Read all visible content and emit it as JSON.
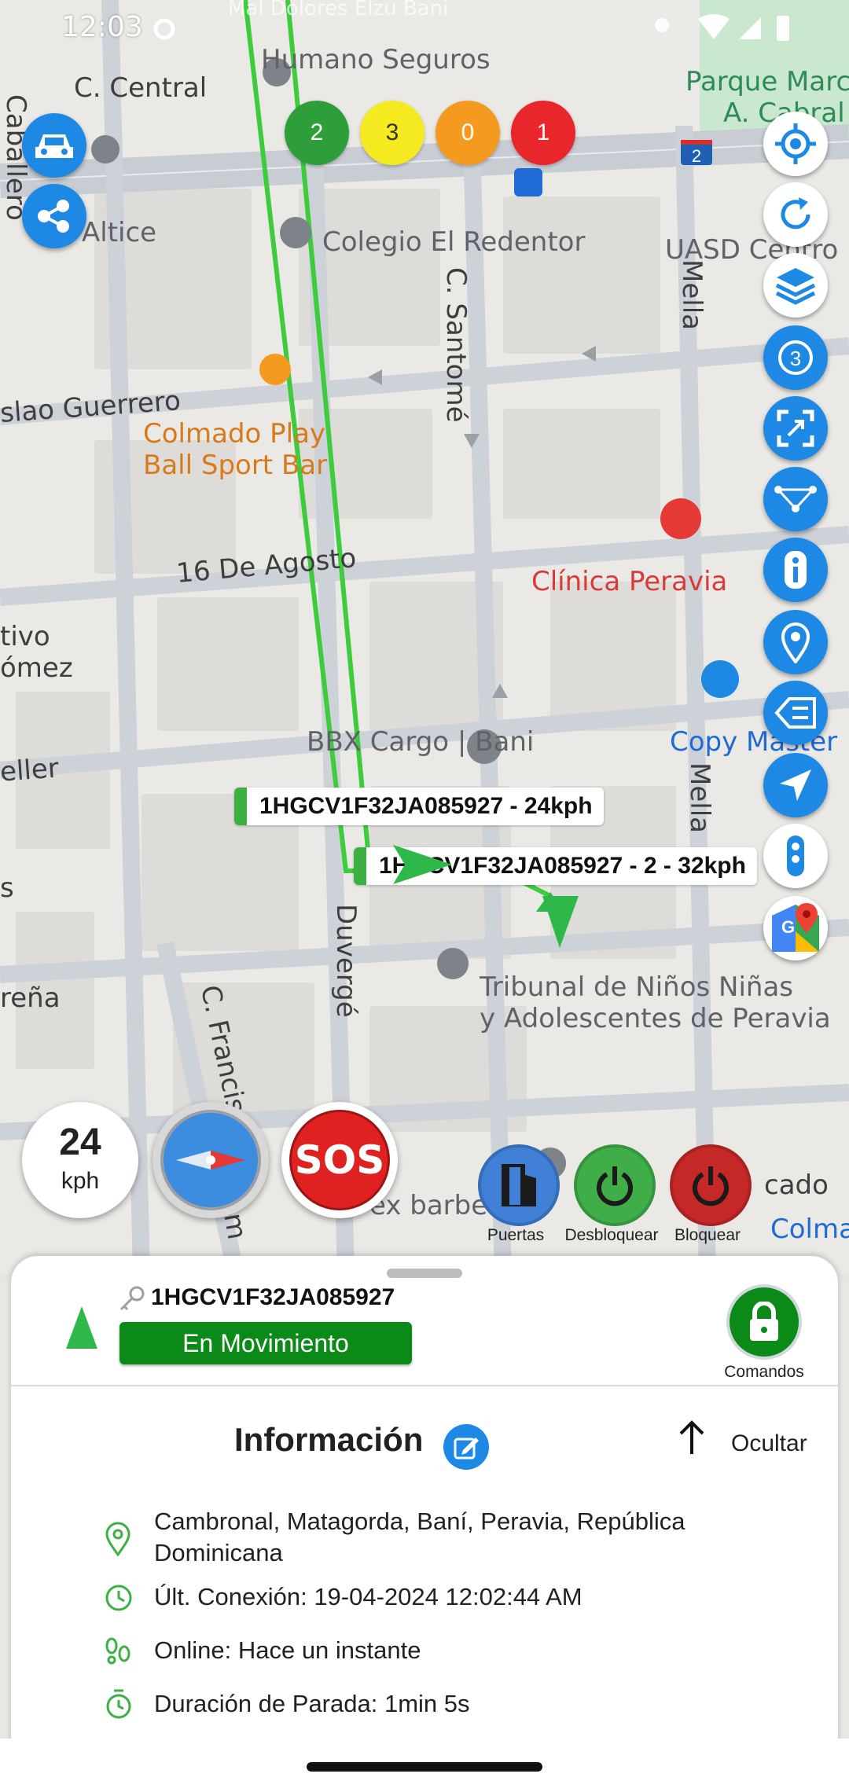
{
  "status_bar": {
    "time": "12:03"
  },
  "map": {
    "streets": {
      "c_central": "C. Central",
      "caballero": "Caballero",
      "c_santome": "C. Santomé",
      "mella_top": "Mella",
      "mella_bottom": "Mella",
      "duverge": "Duvergé",
      "c_francisco": "C. Francisco",
      "lao_guerrero": "slao Guerrero",
      "diez_seis_agosto": "16 De Agosto",
      "tivo": "tivo",
      "gomez": "ómez",
      "eller": "eller",
      "rena": "reña",
      "s_left": "s",
      "top_street": "Mal Dolores Elzu Bani",
      "com": "óm",
      "cado": "cado",
      "colma": "Colma"
    },
    "pois": {
      "humano": "Humano Seguros",
      "parque": "Parque Marc",
      "parque2": "A. Cabral",
      "altice": "Altice",
      "colegio": "Colegio El Redentor",
      "uasd": "UASD Centro",
      "colmado1": "Colmado Play",
      "colmado2": "Ball Sport Bar",
      "clinica": "Clínica Peravia",
      "bbx": "BBX Cargo | Bani",
      "copy": "Copy Master",
      "tribunal1": "Tribunal de Niños Niñas",
      "tribunal2": "y Adolescentes de Peravia",
      "barberia": "ex barbería",
      "route_badge": "2"
    },
    "vehicle_labels": {
      "label1": "1HGCV1F32JA085927 - 24kph",
      "label2": "1HGCV1F32JA085927 - 2 - 32kph"
    }
  },
  "count_badges": [
    {
      "value": "2",
      "color": "#2e9e3a"
    },
    {
      "value": "3",
      "color": "#f5ea20"
    },
    {
      "value": "0",
      "color": "#f39a1f"
    },
    {
      "value": "1",
      "color": "#e8262b"
    }
  ],
  "right_buttons": [
    "my-location-icon",
    "refresh-icon",
    "layers-icon",
    "counter-3-icon",
    "fullscreen-icon",
    "route-icon",
    "info-icon",
    "location-pin-icon",
    "tag-icon",
    "navigation-icon",
    "more-icon",
    "google-maps-icon"
  ],
  "right_button_counter": "3",
  "speed": {
    "value": "24",
    "unit": "kph"
  },
  "sos": {
    "label": "SOS"
  },
  "commands": [
    {
      "label": "Puertas",
      "color": "#3f7fd6"
    },
    {
      "label": "Desbloquear",
      "color": "#3fae49"
    },
    {
      "label": "Bloquear",
      "color": "#c62828"
    }
  ],
  "sheet": {
    "vin": "1HGCV1F32JA085927",
    "status": "En Movimiento",
    "status_color": "#0c8a17",
    "commands_label": "Comandos",
    "section_title": "Información",
    "hide_label": "Ocultar",
    "rows": [
      {
        "icon": "location-pin-icon",
        "text": "Cambronal, Matagorda, Baní, Peravia, República Dominicana"
      },
      {
        "icon": "clock-icon",
        "text": "Últ. Conexión: 19-04-2024 12:02:44 AM"
      },
      {
        "icon": "footprints-icon",
        "text": "Online: Hace un instante"
      },
      {
        "icon": "timer-icon",
        "text": "Duración de Parada: 1min 5s"
      }
    ]
  }
}
